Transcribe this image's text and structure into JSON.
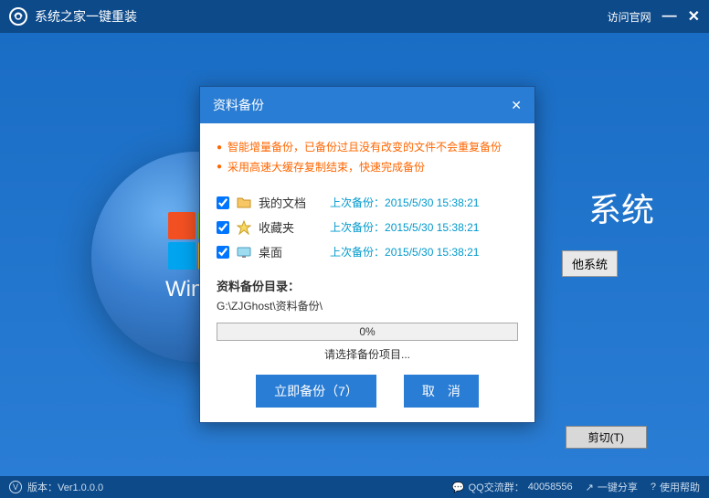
{
  "titlebar": {
    "app_title": "系统之家一键重装",
    "visit_link": "访问官网"
  },
  "background": {
    "orb_text": "Windo",
    "side_text": "系统",
    "other_system_btn": "他系统"
  },
  "modal": {
    "title": "资料备份",
    "bullets": [
      "智能增量备份，已备份过且没有改变的文件不会重复备份",
      "采用高速大缓存复制结束，快速完成备份"
    ],
    "items": [
      {
        "name": "我的文档",
        "last_prefix": "上次备份：",
        "last_time": "2015/5/30 15:38:21",
        "checked": true
      },
      {
        "name": "收藏夹",
        "last_prefix": "上次备份：",
        "last_time": "2015/5/30 15:38:21",
        "checked": true
      },
      {
        "name": "桌面",
        "last_prefix": "上次备份：",
        "last_time": "2015/5/30 15:38:21",
        "checked": true
      }
    ],
    "dir_label": "资料备份目录：",
    "dir_path": "G:\\ZJGhost\\资料备份\\",
    "progress_pct": "0%",
    "hint": "请选择备份项目...",
    "backup_btn": "立即备份（7）",
    "cancel_btn": "取　消"
  },
  "context": {
    "cut_btn": "剪切(T)"
  },
  "footer": {
    "version_label": "版本：",
    "version": "Ver1.0.0.0",
    "qq_label": "QQ交流群：",
    "qq": "40058556",
    "share": "一键分享",
    "help": "使用帮助"
  }
}
